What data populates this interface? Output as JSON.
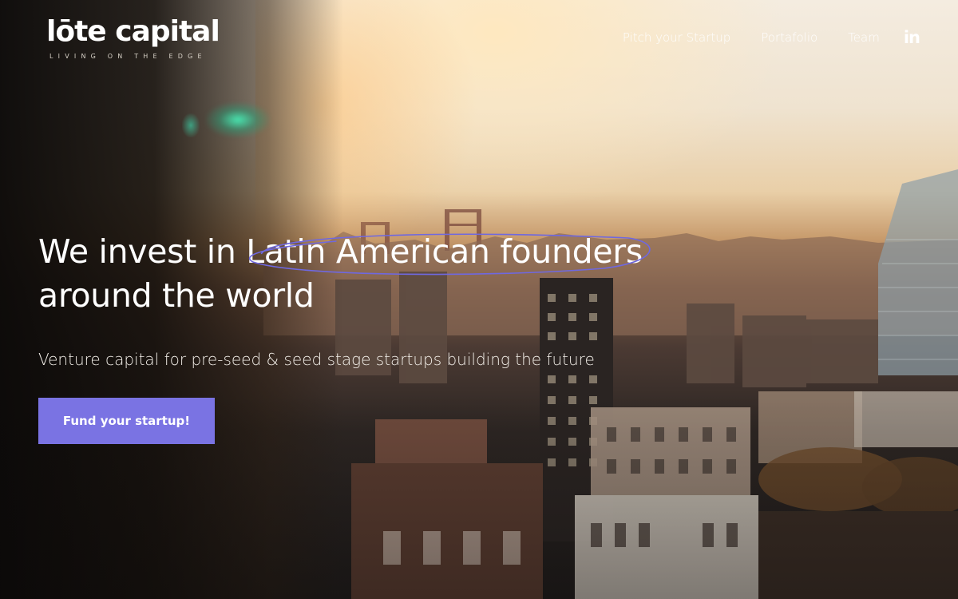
{
  "brand": {
    "name": "lōte capital",
    "tagline": "LIVING ON THE EDGE"
  },
  "nav": {
    "items": [
      {
        "label": "Pitch your Startup"
      },
      {
        "label": "Portafolio"
      },
      {
        "label": "Team"
      }
    ],
    "social_icon_label": "in"
  },
  "hero": {
    "headline_before": "We invest in ",
    "headline_highlight": "Latin American founders",
    "headline_after": "around the world",
    "subheadline": "Venture capital for pre-seed & seed stage startups building the future",
    "cta_label": "Fund your startup!"
  },
  "colors": {
    "accent": "#7a73e3",
    "highlight_ring": "#6f68e0",
    "text": "#ffffff"
  },
  "icons": {
    "social": "linkedin-icon"
  }
}
